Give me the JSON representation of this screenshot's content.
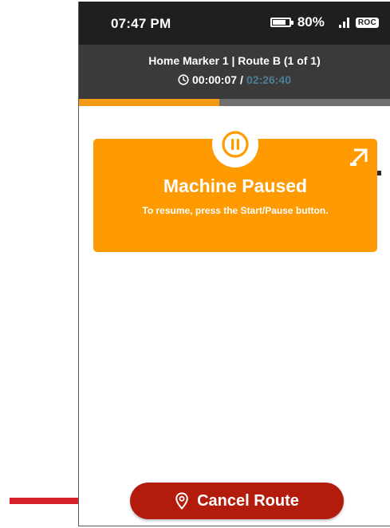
{
  "status_bar": {
    "time": "07:47 PM",
    "battery_percent": "80%",
    "battery_level": 0.8,
    "carrier": "ROC",
    "battery_icon": "battery-icon",
    "signal_icon": "signal-icon"
  },
  "header": {
    "route_title": "Home Marker 1 | Route B (1 of 1)",
    "elapsed": "00:00:07",
    "separator": " / ",
    "total": "02:26:40",
    "clock_icon": "clock-icon"
  },
  "progress": {
    "fraction": 0.45,
    "fill_color": "#f39a15",
    "track_color": "#6f6f6f"
  },
  "paused_card": {
    "title": "Machine Paused",
    "message": "To resume, press the Start/Pause button.",
    "color": "#ff9a00",
    "pause_icon": "pause-icon",
    "expand_icon": "expand-icon"
  },
  "cancel_button": {
    "label": "Cancel Route",
    "color": "#b31b0c",
    "icon": "location-pin-icon"
  },
  "annotation": {
    "arrow_color": "#d8202a",
    "arrow_icon": "arrow-right-icon"
  }
}
